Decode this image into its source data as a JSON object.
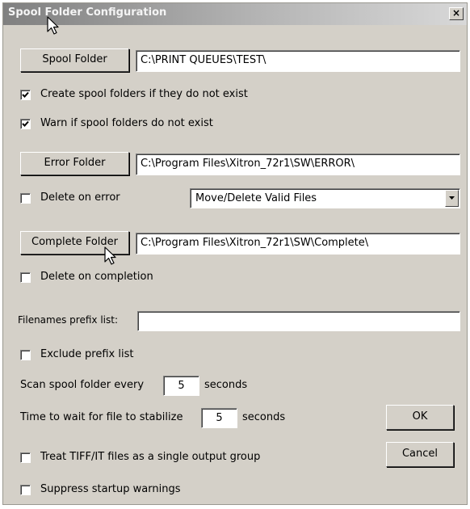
{
  "window": {
    "title": "Spool Folder Configuration",
    "close_label": "×"
  },
  "spool": {
    "button": "Spool Folder",
    "path": "C:\\PRINT QUEUES\\TEST\\",
    "create_label": "Create spool folders if they do not exist",
    "create_checked": true,
    "warn_label": "Warn if spool folders do not exist",
    "warn_checked": true
  },
  "error": {
    "button": "Error Folder",
    "path": "C:\\Program Files\\Xitron_72r1\\SW\\ERROR\\",
    "delete_label": "Delete on error",
    "delete_checked": false,
    "action_selected": "Move/Delete Valid Files"
  },
  "complete": {
    "button": "Complete Folder",
    "path": "C:\\Program Files\\Xitron_72r1\\SW\\Complete\\",
    "delete_label": "Delete on completion",
    "delete_checked": false
  },
  "prefix": {
    "label": "Filenames prefix list:",
    "value": "",
    "exclude_label": "Exclude prefix list",
    "exclude_checked": false
  },
  "scan": {
    "label": "Scan spool folder every",
    "value": "5",
    "unit": "seconds"
  },
  "stabilize": {
    "label": "Time to wait for file to stabilize",
    "value": "5",
    "unit": "seconds"
  },
  "options": {
    "tiff_label": "Treat TIFF/IT files as a single output group",
    "tiff_checked": false,
    "suppress_label": "Suppress startup warnings",
    "suppress_checked": false
  },
  "buttons": {
    "ok": "OK",
    "cancel": "Cancel"
  }
}
